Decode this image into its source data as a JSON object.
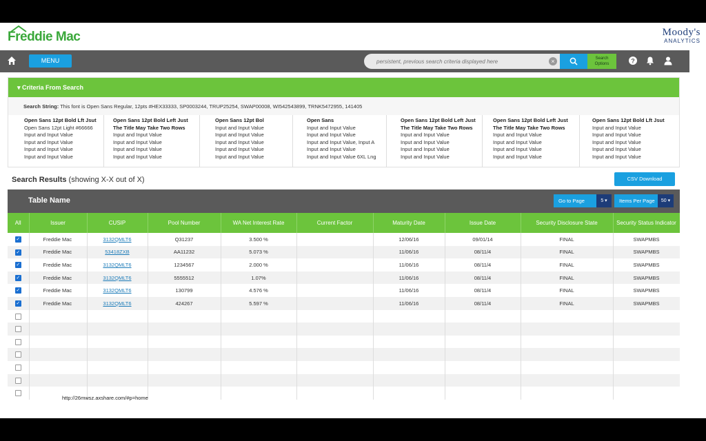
{
  "brand": {
    "left_logo": "Freddie Mac",
    "right_logo_line1": "Moody's",
    "right_logo_line2": "ANALYTICS"
  },
  "nav": {
    "menu_label": "MENU",
    "search_placeholder": "persistent, previous search criteria displayed here",
    "search_options_line1": "Search",
    "search_options_line2": "Options",
    "icons": [
      "home-icon",
      "close-icon",
      "search-icon",
      "help-icon",
      "bell-icon",
      "user-icon"
    ]
  },
  "criteria": {
    "header": "▾ Criteria From Search",
    "search_string_label": "Search String:",
    "search_string_value": "This font is Open Sans Regular, 12pts #HEX33333, SP0003244, TRUP25254, SWAP00008, WI542543899, TRNK5472955, 141405",
    "columns": [
      {
        "heading": "Open Sans 12pt Bold Lft Jsut",
        "lines": [
          "Open Sans 12pt Light #66666",
          "Input  and Input Value",
          "Input  and Input Value",
          "Input  and Input Value",
          "Input  and Input Value"
        ]
      },
      {
        "heading": "Open Sans 12pt Bold Left Just",
        "heading2": "The Title May Take Two Rows",
        "lines": [
          "Input  and Input Value",
          "Input  and Input Value",
          "Input  and Input Value",
          "Input  and Input Value"
        ]
      },
      {
        "heading": "Open Sans 12pt Bol",
        "lines": [
          "Input  and Input Value",
          "Input  and Input Value",
          "Input  and Input Value",
          "Input  and Input Value",
          "Input  and Input Value"
        ]
      },
      {
        "heading": "Open Sans",
        "lines": [
          "Input  and Input Value",
          "Input  and Input Value",
          "Input  and Input Value, Input A",
          "Input  and Input Value",
          "Input  and Input Value 6XL  Lng"
        ]
      },
      {
        "heading": "Open Sans 12pt Bold Left Just",
        "heading2": "The Title May Take Two Rows",
        "lines": [
          "Input  and Input Value",
          "Input  and Input Value",
          "Input  and Input Value",
          "Input  and Input Value"
        ]
      },
      {
        "heading": "Open Sans 12pt Bold Left Just",
        "heading2": "The Title May Take Two Rows",
        "lines": [
          "Input  and Input Value",
          "Input  and Input Value",
          "Input  and Input Value",
          "Input  and Input Value"
        ]
      },
      {
        "heading": "Open Sans 12pt Bold Lft Jsut",
        "lines": [
          "Input  and Input Value",
          "Input  and Input Value",
          "Input  and Input Value",
          "Input  and Input Value",
          "Input  and Input Value"
        ]
      }
    ]
  },
  "results": {
    "title_bold": "Search Results",
    "title_rest": "(showing X-X out of X)",
    "csv_label": "CSV Download",
    "table_name": "Table Name",
    "goto_label": "Go to Page",
    "goto_value": "5",
    "ipp_label": "Items Per Page",
    "ipp_value": "50",
    "columns": [
      "All",
      "Issuer",
      "CUSIP",
      "Pool Number",
      "WA Net Interest Rate",
      "Current Factor",
      "Maturity Date",
      "Issue Date",
      "Security Disclosure State",
      "Security Status Indicator"
    ],
    "rows": [
      {
        "checked": true,
        "issuer": "Freddie Mac",
        "cusip": "3132QMLT6",
        "pool": "Q31237",
        "rate": "3.500 %",
        "factor": "",
        "maturity": "12/06/16",
        "issue": "09/01/14",
        "state": "FINAL",
        "status": "SWAPMBS"
      },
      {
        "checked": true,
        "issuer": "Freddie Mac",
        "cusip": "53418ZXB",
        "pool": "AA11232",
        "rate": "5.073 %",
        "factor": "",
        "maturity": "11/06/16",
        "issue": "08/11/4",
        "state": "FINAL",
        "status": "SWAPMBS"
      },
      {
        "checked": true,
        "issuer": "Freddie Mac",
        "cusip": "3132QMLT6",
        "pool": "1234567",
        "rate": "2.000 %",
        "factor": "",
        "maturity": "11/06/16",
        "issue": "08/11/4",
        "state": "FINAL",
        "status": "SWAPMBS"
      },
      {
        "checked": true,
        "issuer": "Freddie Mac",
        "cusip": "3132QMLT6",
        "pool": "5555512",
        "rate": "1.07%",
        "factor": "",
        "maturity": "11/06/16",
        "issue": "08/11/4",
        "state": "FINAL",
        "status": "SWAPMBS"
      },
      {
        "checked": true,
        "issuer": "Freddie Mac",
        "cusip": "3132QMLT6",
        "pool": "130799",
        "rate": "4.576 %",
        "factor": "",
        "maturity": "11/06/16",
        "issue": "08/11/4",
        "state": "FINAL",
        "status": "SWAPMBS"
      },
      {
        "checked": true,
        "issuer": "Freddie Mac",
        "cusip": "3132QMLT6",
        "pool": "424267",
        "rate": "5.597 %",
        "factor": "",
        "maturity": "11/06/16",
        "issue": "08/11/4",
        "state": "FINAL",
        "status": "SWAPMBS"
      },
      {
        "checked": false
      },
      {
        "checked": false
      },
      {
        "checked": false
      },
      {
        "checked": false
      },
      {
        "checked": false
      },
      {
        "checked": false
      },
      {
        "checked": false
      }
    ]
  },
  "footer_url": "http://26mwsz.axshare.com/#p=home",
  "colors": {
    "green": "#6cc43c",
    "blue": "#1aa0e0",
    "navy": "#1d3c78",
    "dark_gray": "#5a5a5a"
  }
}
